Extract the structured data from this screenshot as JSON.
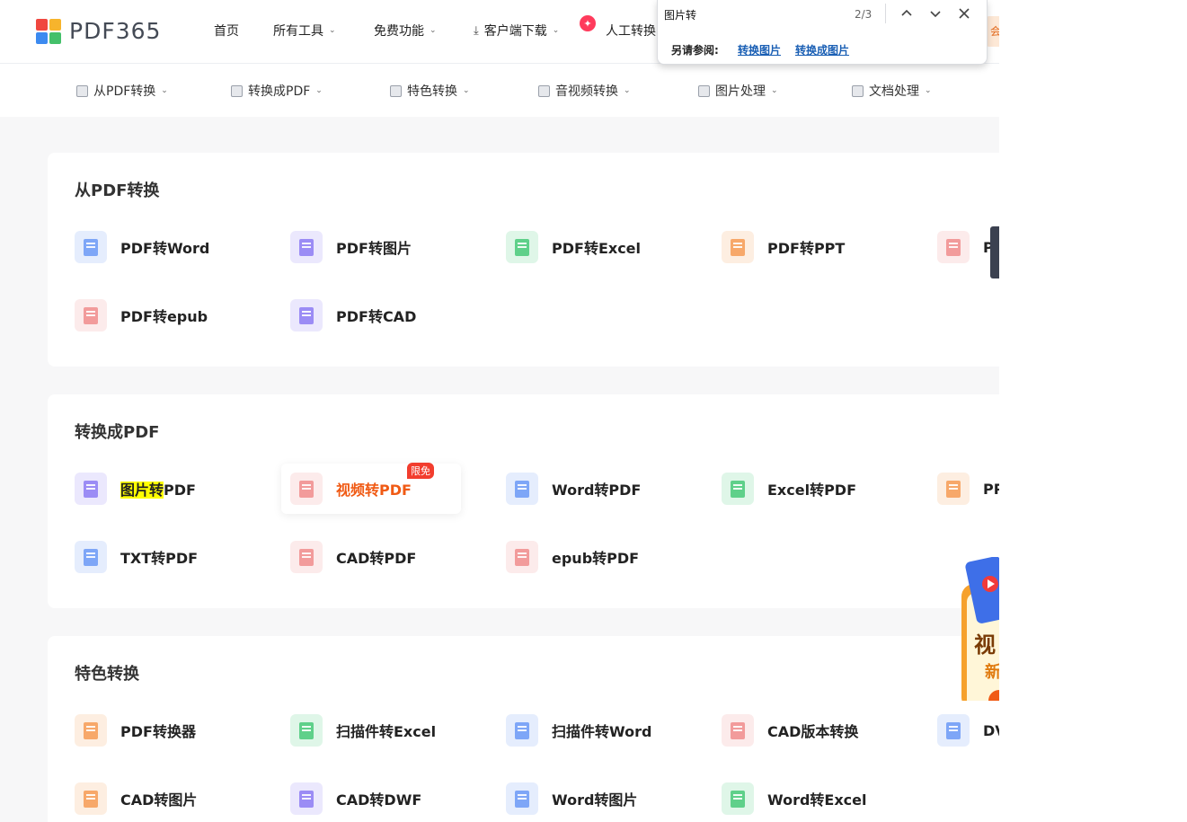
{
  "header": {
    "logo_text": "PDF365",
    "nav": [
      {
        "label": "首页"
      },
      {
        "label": "所有工具"
      },
      {
        "label": "免费功能"
      },
      {
        "label": "客户端下载"
      },
      {
        "label": "人工转换"
      }
    ],
    "vip_label": "会"
  },
  "subnav": [
    {
      "label": "从PDF转换"
    },
    {
      "label": "转换成PDF"
    },
    {
      "label": "特色转换"
    },
    {
      "label": "音视频转换"
    },
    {
      "label": "图片处理"
    },
    {
      "label": "文档处理"
    }
  ],
  "sections": [
    {
      "title": "从PDF转换",
      "tools": [
        {
          "label": "PDF转Word",
          "color": "#7ea6f7"
        },
        {
          "label": "PDF转图片",
          "color": "#9b8cf5"
        },
        {
          "label": "PDF转Excel",
          "color": "#5fd08a"
        },
        {
          "label": "PDF转PPT",
          "color": "#f7a86a"
        },
        {
          "label": "P",
          "color": "#f29b9b"
        },
        {
          "label": "PDF转epub",
          "color": "#f29b9b"
        },
        {
          "label": "PDF转CAD",
          "color": "#9b8cf5"
        }
      ]
    },
    {
      "title": "转换成PDF",
      "tools": [
        {
          "label_hl": "图片转",
          "label_rest": "PDF",
          "color": "#9b8cf5"
        },
        {
          "label": "视频转PDF",
          "color": "#f29b9b",
          "badge": "限免"
        },
        {
          "label": "Word转PDF",
          "color": "#7ea6f7"
        },
        {
          "label": "Excel转PDF",
          "color": "#5fd08a"
        },
        {
          "label": "PP",
          "color": "#f7a86a"
        },
        {
          "label": "TXT转PDF",
          "color": "#7ea6f7"
        },
        {
          "label": "CAD转PDF",
          "color": "#f29b9b"
        },
        {
          "label": "epub转PDF",
          "color": "#f29b9b"
        }
      ]
    },
    {
      "title": "特色转换",
      "tools": [
        {
          "label": "PDF转换器",
          "color": "#f7a86a"
        },
        {
          "label": "扫描件转Excel",
          "color": "#5fd08a"
        },
        {
          "label": "扫描件转Word",
          "color": "#7ea6f7"
        },
        {
          "label": "CAD版本转换",
          "color": "#f29b9b"
        },
        {
          "label": "DV",
          "color": "#7ea6f7"
        },
        {
          "label": "CAD转图片",
          "color": "#f7a86a"
        },
        {
          "label": "CAD转DWF",
          "color": "#9b8cf5"
        },
        {
          "label": "Word转图片",
          "color": "#7ea6f7"
        },
        {
          "label": "Word转Excel",
          "color": "#5fd08a"
        }
      ]
    }
  ],
  "find_bar": {
    "query": "图片转",
    "count": "2/3",
    "also_label": "另请参阅:",
    "links": [
      "转换图片",
      "转换成图片"
    ]
  },
  "promo": {
    "line1": "视",
    "line2": "新"
  }
}
